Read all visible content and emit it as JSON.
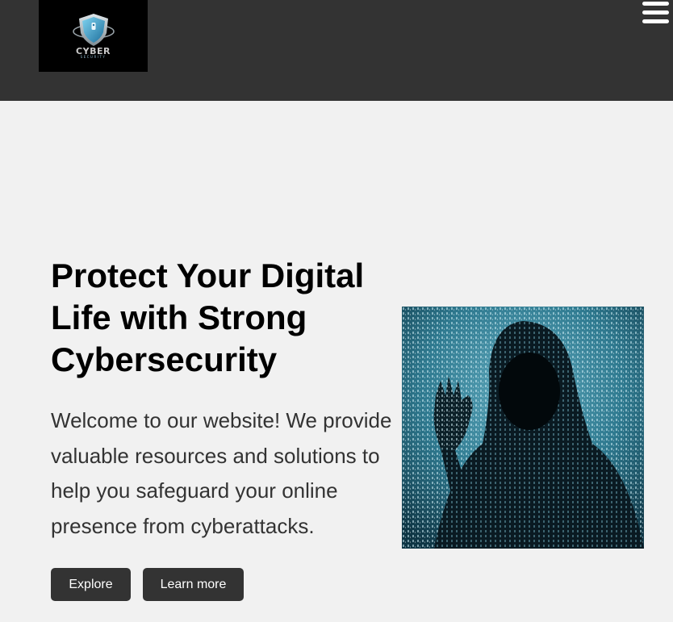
{
  "header": {
    "logo": {
      "text": "CYBER",
      "subtext": "SECURITY",
      "icon": "shield-lock-icon"
    },
    "menu_icon": "hamburger-menu-icon",
    "background": "#333333"
  },
  "hero": {
    "title": "Protect Your Digital Life with Strong Cybersecurity",
    "description": "Welcome to our website! We provide valuable resources and solutions to help you safeguard your online presence from cyberattacks.",
    "buttons": [
      {
        "label": "Explore"
      },
      {
        "label": "Learn more"
      }
    ],
    "image": "hooded-hacker-image"
  },
  "colors": {
    "page_background": "#f1f1f1",
    "button_background": "#333333",
    "button_text": "#ffffff",
    "accent": "#4aa3c4"
  }
}
